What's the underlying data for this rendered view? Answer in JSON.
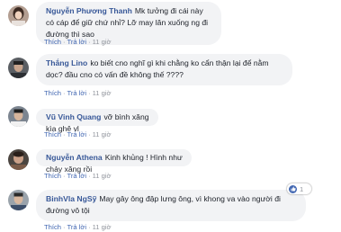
{
  "actions": {
    "like": "Thích",
    "reply": "Trả lời",
    "separator": "·"
  },
  "comments": [
    {
      "author": "Nguyễn Phương Thanh",
      "text": "Mk tưởng đi cái này có cáp để giữ chứ nhỉ? Lỡ may lăn xuống ng đi đường thì sao",
      "time": "11 giờ"
    },
    {
      "author": "Thắng Lino",
      "text": "ko biết cno nghĩ gì khi chằng ko cẩn thận lại để nằm dọc? đầu cno có vấn đề không thế ????",
      "time": "11 giờ"
    },
    {
      "author": "Vũ Vinh Quang",
      "text": "vỡ bình xăng kìa ghê vl",
      "time": "11 giờ"
    },
    {
      "author": "Nguyễn Athena",
      "text": "Kinh khủng ! Hình như chảy xăng rồi",
      "time": "11 giờ"
    },
    {
      "author": "BinhVla NgSỹ",
      "text": "May gây ông đập lưng ông, vì khong va vào người đi đường vô tội",
      "time": "11 giờ",
      "reaction_count": "1"
    }
  ]
}
